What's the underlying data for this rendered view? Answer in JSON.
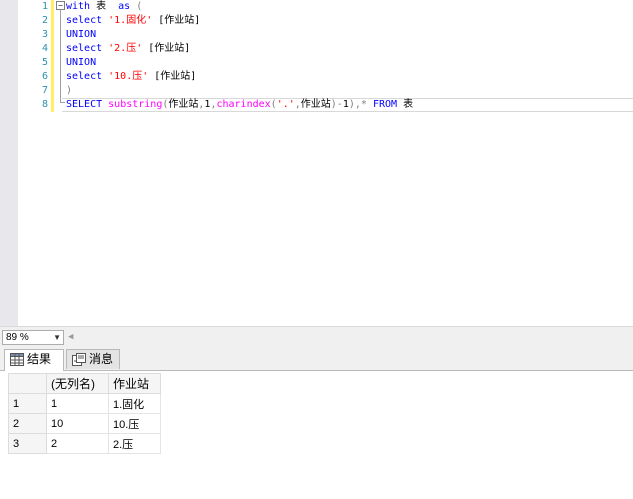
{
  "editor": {
    "line_numbers": [
      "1",
      "2",
      "3",
      "4",
      "5",
      "6",
      "7",
      "8"
    ],
    "lines": [
      [
        {
          "t": "with",
          "c": "kw"
        },
        {
          "t": " 表  ",
          "c": ""
        },
        {
          "t": "as",
          "c": "kw"
        },
        {
          "t": " (",
          "c": "gray"
        }
      ],
      [
        {
          "t": "select",
          "c": "kw"
        },
        {
          "t": " '1.固化'",
          "c": "str"
        },
        {
          "t": " [作业站]",
          "c": ""
        }
      ],
      [
        {
          "t": "UNION",
          "c": "kw"
        }
      ],
      [
        {
          "t": "select",
          "c": "kw"
        },
        {
          "t": " '2.压'",
          "c": "str"
        },
        {
          "t": " [作业站]",
          "c": ""
        }
      ],
      [
        {
          "t": "UNION",
          "c": "kw"
        }
      ],
      [
        {
          "t": "select",
          "c": "kw"
        },
        {
          "t": " '10.压'",
          "c": "str"
        },
        {
          "t": " [作业站]",
          "c": ""
        }
      ],
      [
        {
          "t": ")",
          "c": "gray"
        }
      ],
      [
        {
          "t": "SELECT",
          "c": "kw"
        },
        {
          "t": " ",
          "c": ""
        },
        {
          "t": "substring",
          "c": "fn"
        },
        {
          "t": "(",
          "c": "gray"
        },
        {
          "t": "作业站",
          "c": ""
        },
        {
          "t": ",",
          "c": "gray"
        },
        {
          "t": "1",
          "c": ""
        },
        {
          "t": ",",
          "c": "gray"
        },
        {
          "t": "charindex",
          "c": "fn"
        },
        {
          "t": "(",
          "c": "gray"
        },
        {
          "t": "'.'",
          "c": "str"
        },
        {
          "t": ",",
          "c": "gray"
        },
        {
          "t": "作业站",
          "c": ""
        },
        {
          "t": ")-",
          "c": "gray"
        },
        {
          "t": "1",
          "c": ""
        },
        {
          "t": "),",
          "c": "gray"
        },
        {
          "t": "*",
          "c": "gray"
        },
        {
          "t": " FROM",
          "c": "kw"
        },
        {
          "t": " 表",
          "c": ""
        }
      ]
    ]
  },
  "zoom": {
    "value": "89 %"
  },
  "tabs": [
    {
      "label": "结果",
      "icon": "grid-icon"
    },
    {
      "label": "消息",
      "icon": "messages-icon"
    }
  ],
  "results": {
    "columns": [
      "(无列名)",
      "作业站"
    ],
    "rows": [
      {
        "num": "1",
        "cells": [
          "1",
          "1.固化"
        ]
      },
      {
        "num": "2",
        "cells": [
          "10",
          "10.压"
        ]
      },
      {
        "num": "3",
        "cells": [
          "2",
          "2.压"
        ]
      }
    ]
  }
}
